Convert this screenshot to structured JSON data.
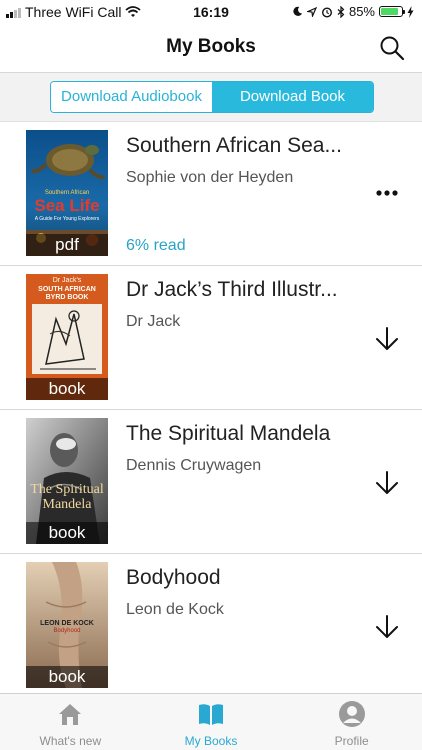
{
  "status_bar": {
    "carrier": "Three WiFi Call",
    "time": "16:19",
    "battery": "85%",
    "battery_level": 0.85,
    "icons": [
      "signal-icon",
      "wifi-icon",
      "moon-icon",
      "location-icon",
      "alarm-icon",
      "bluetooth-icon",
      "battery-icon",
      "charging-icon"
    ]
  },
  "header": {
    "title": "My Books",
    "search_icon": "search-icon"
  },
  "segments": {
    "audiobook": "Download Audiobook",
    "book": "Download Book",
    "selected": "book",
    "accent_color": "#29b9dd"
  },
  "books": [
    {
      "title": "Southern African Sea...",
      "author": "Sophie von der Heyden",
      "format": "pdf",
      "progress": "6% read",
      "action": "more-icon",
      "cover_text": {
        "top": "Southern African",
        "main": "Sea Life",
        "sub": "A Guide For Young Explorers"
      }
    },
    {
      "title": "Dr Jack’s Third Illustr...",
      "author": "Dr Jack",
      "format": "book",
      "action": "download-icon",
      "cover_text": {
        "top": "Dr Jack's",
        "main": "SOUTH AFRICAN BYRD BOOK"
      }
    },
    {
      "title": "The Spiritual Mandela",
      "author": "Dennis Cruywagen",
      "format": "book",
      "action": "download-icon",
      "cover_text": {
        "main": "The Spiritual Mandela"
      }
    },
    {
      "title": "Bodyhood",
      "author": "Leon de Kock",
      "format": "book",
      "action": "download-icon",
      "cover_text": {
        "top": "LEON DE KOCK",
        "main": "Bodyhood"
      }
    }
  ],
  "tabs": [
    {
      "label": "What's new",
      "icon": "home-icon",
      "active": false
    },
    {
      "label": "My Books",
      "icon": "book-icon",
      "active": true
    },
    {
      "label": "Profile",
      "icon": "profile-icon",
      "active": false
    }
  ]
}
